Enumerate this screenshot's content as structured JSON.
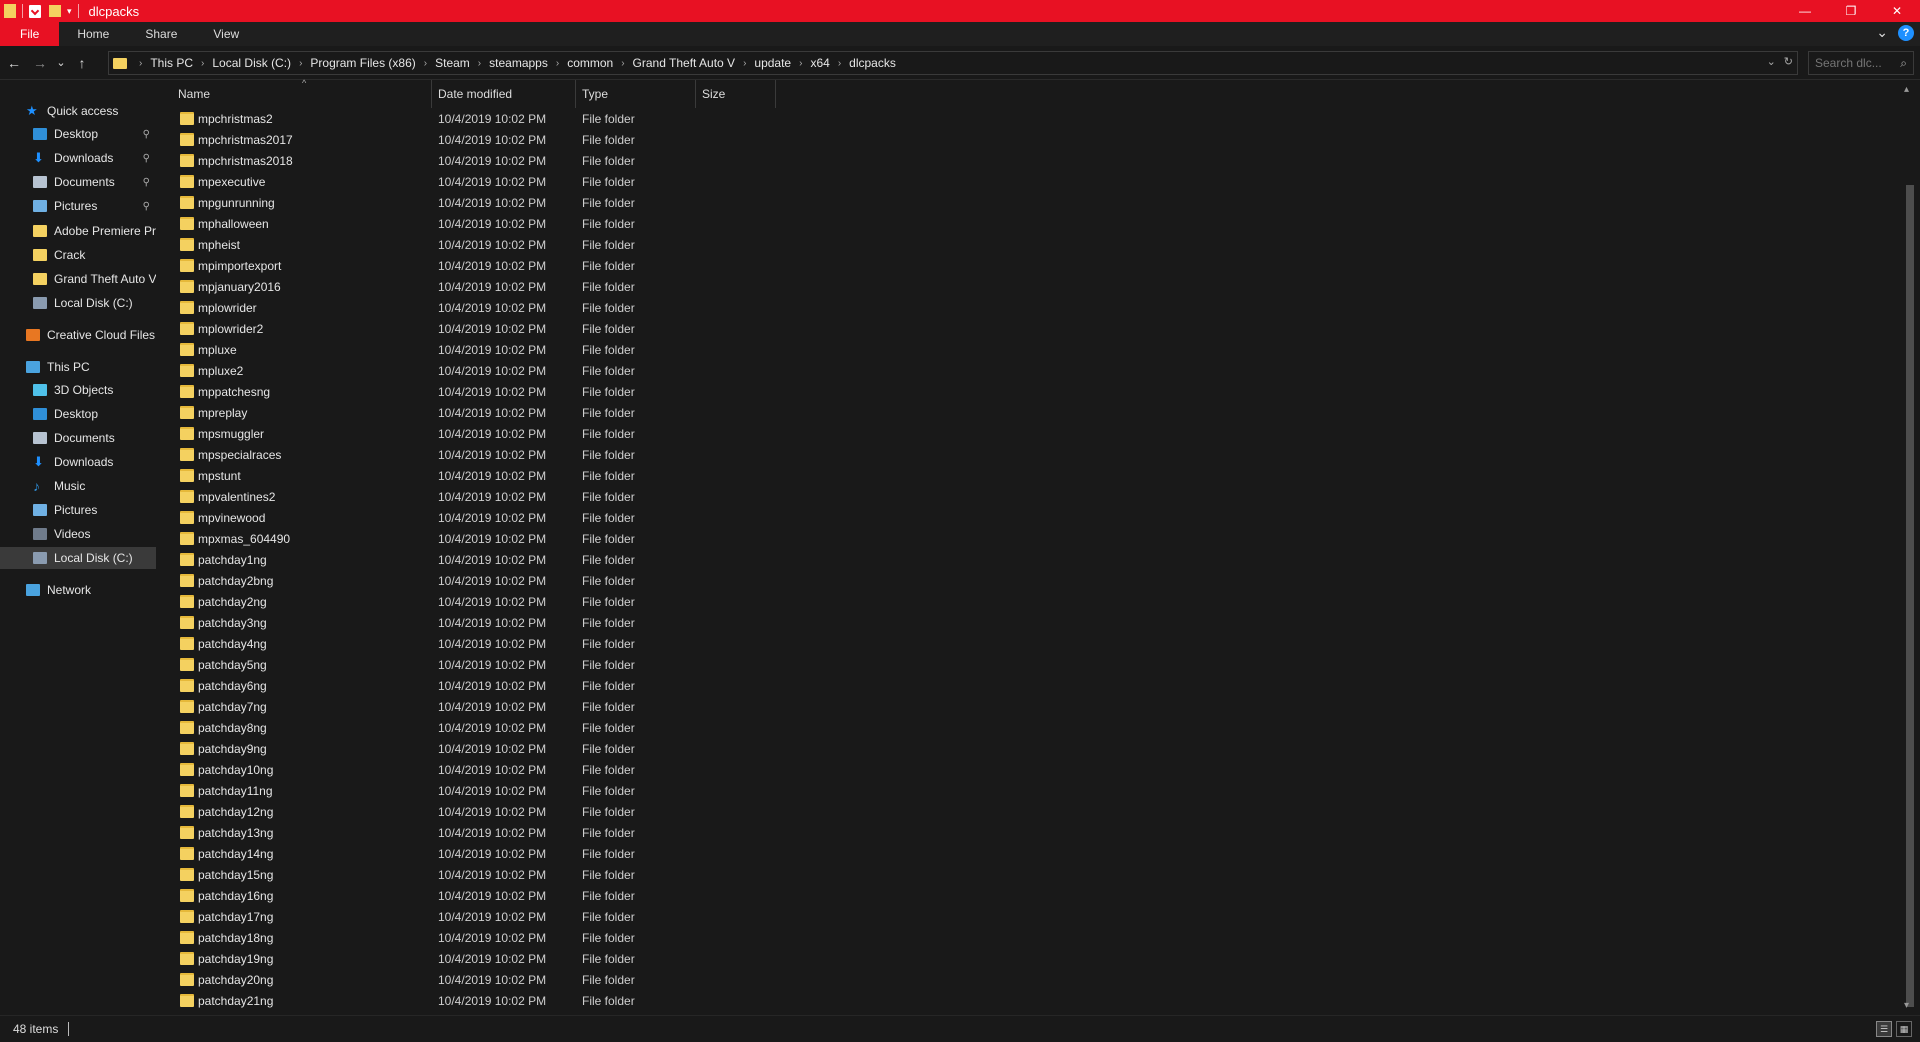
{
  "window": {
    "title": "dlcpacks",
    "controls": {
      "minimize": "—",
      "restore": "❐",
      "close": "✕"
    }
  },
  "ribbon": {
    "tabs": [
      "File",
      "Home",
      "Share",
      "View"
    ],
    "help": "?",
    "expand": "⌄"
  },
  "nav": {
    "back": "←",
    "forward": "→",
    "recent": "⌄",
    "up": "↑"
  },
  "address": {
    "crumbs": [
      "This PC",
      "Local Disk (C:)",
      "Program Files (x86)",
      "Steam",
      "steamapps",
      "common",
      "Grand Theft Auto V",
      "update",
      "x64",
      "dlcpacks"
    ],
    "dropdown": "⌄",
    "refresh": "↻"
  },
  "search": {
    "placeholder": "Search dlc...",
    "icon": "⌕"
  },
  "sidebar": {
    "items": [
      {
        "label": "Quick access",
        "icon": "star-icon",
        "color": "#1e90ff",
        "level": 0
      },
      {
        "label": "Desktop",
        "icon": "desktop-icon",
        "color": "#2f8fd8",
        "level": 1,
        "pinned": true
      },
      {
        "label": "Downloads",
        "icon": "download-icon",
        "color": "#1e90ff",
        "level": 1,
        "pinned": true
      },
      {
        "label": "Documents",
        "icon": "documents-icon",
        "color": "#b7c3d1",
        "level": 1,
        "pinned": true
      },
      {
        "label": "Pictures",
        "icon": "pictures-icon",
        "color": "#6fb0e3",
        "level": 1,
        "pinned": true
      },
      {
        "label": "Adobe Premiere Pro",
        "icon": "folder-icon",
        "color": "#f4d160",
        "level": 1
      },
      {
        "label": "Crack",
        "icon": "folder-icon",
        "color": "#f4d160",
        "level": 1
      },
      {
        "label": "Grand Theft Auto V",
        "icon": "folder-icon",
        "color": "#f4d160",
        "level": 1
      },
      {
        "label": "Local Disk (C:)",
        "icon": "drive-icon",
        "color": "#8a9bb0",
        "level": 1
      },
      {
        "label": "Creative Cloud Files",
        "icon": "creative-cloud-icon",
        "color": "#e87722",
        "level": 0
      },
      {
        "label": "This PC",
        "icon": "computer-icon",
        "color": "#4aa3df",
        "level": 0
      },
      {
        "label": "3D Objects",
        "icon": "3d-objects-icon",
        "color": "#4fc1e9",
        "level": 1
      },
      {
        "label": "Desktop",
        "icon": "desktop-icon",
        "color": "#2f8fd8",
        "level": 1
      },
      {
        "label": "Documents",
        "icon": "documents-icon",
        "color": "#b7c3d1",
        "level": 1
      },
      {
        "label": "Downloads",
        "icon": "download-icon",
        "color": "#1e90ff",
        "level": 1
      },
      {
        "label": "Music",
        "icon": "music-icon",
        "color": "#2f8fd8",
        "level": 1
      },
      {
        "label": "Pictures",
        "icon": "pictures-icon",
        "color": "#6fb0e3",
        "level": 1
      },
      {
        "label": "Videos",
        "icon": "videos-icon",
        "color": "#6f7b8b",
        "level": 1
      },
      {
        "label": "Local Disk (C:)",
        "icon": "drive-icon",
        "color": "#8a9bb0",
        "level": 1,
        "selected": true
      },
      {
        "label": "Network",
        "icon": "network-icon",
        "color": "#4aa3df",
        "level": 0
      }
    ],
    "pin_glyph": "📌"
  },
  "columns": {
    "name": "Name",
    "date": "Date modified",
    "type": "Type",
    "size": "Size"
  },
  "files": [
    {
      "name": "mpchristmas2",
      "date": "10/4/2019 10:02 PM",
      "type": "File folder"
    },
    {
      "name": "mpchristmas2017",
      "date": "10/4/2019 10:02 PM",
      "type": "File folder"
    },
    {
      "name": "mpchristmas2018",
      "date": "10/4/2019 10:02 PM",
      "type": "File folder"
    },
    {
      "name": "mpexecutive",
      "date": "10/4/2019 10:02 PM",
      "type": "File folder"
    },
    {
      "name": "mpgunrunning",
      "date": "10/4/2019 10:02 PM",
      "type": "File folder"
    },
    {
      "name": "mphalloween",
      "date": "10/4/2019 10:02 PM",
      "type": "File folder"
    },
    {
      "name": "mpheist",
      "date": "10/4/2019 10:02 PM",
      "type": "File folder"
    },
    {
      "name": "mpimportexport",
      "date": "10/4/2019 10:02 PM",
      "type": "File folder"
    },
    {
      "name": "mpjanuary2016",
      "date": "10/4/2019 10:02 PM",
      "type": "File folder"
    },
    {
      "name": "mplowrider",
      "date": "10/4/2019 10:02 PM",
      "type": "File folder"
    },
    {
      "name": "mplowrider2",
      "date": "10/4/2019 10:02 PM",
      "type": "File folder"
    },
    {
      "name": "mpluxe",
      "date": "10/4/2019 10:02 PM",
      "type": "File folder"
    },
    {
      "name": "mpluxe2",
      "date": "10/4/2019 10:02 PM",
      "type": "File folder"
    },
    {
      "name": "mppatchesng",
      "date": "10/4/2019 10:02 PM",
      "type": "File folder"
    },
    {
      "name": "mpreplay",
      "date": "10/4/2019 10:02 PM",
      "type": "File folder"
    },
    {
      "name": "mpsmuggler",
      "date": "10/4/2019 10:02 PM",
      "type": "File folder"
    },
    {
      "name": "mpspecialraces",
      "date": "10/4/2019 10:02 PM",
      "type": "File folder"
    },
    {
      "name": "mpstunt",
      "date": "10/4/2019 10:02 PM",
      "type": "File folder"
    },
    {
      "name": "mpvalentines2",
      "date": "10/4/2019 10:02 PM",
      "type": "File folder"
    },
    {
      "name": "mpvinewood",
      "date": "10/4/2019 10:02 PM",
      "type": "File folder"
    },
    {
      "name": "mpxmas_604490",
      "date": "10/4/2019 10:02 PM",
      "type": "File folder"
    },
    {
      "name": "patchday1ng",
      "date": "10/4/2019 10:02 PM",
      "type": "File folder"
    },
    {
      "name": "patchday2bng",
      "date": "10/4/2019 10:02 PM",
      "type": "File folder"
    },
    {
      "name": "patchday2ng",
      "date": "10/4/2019 10:02 PM",
      "type": "File folder"
    },
    {
      "name": "patchday3ng",
      "date": "10/4/2019 10:02 PM",
      "type": "File folder"
    },
    {
      "name": "patchday4ng",
      "date": "10/4/2019 10:02 PM",
      "type": "File folder"
    },
    {
      "name": "patchday5ng",
      "date": "10/4/2019 10:02 PM",
      "type": "File folder"
    },
    {
      "name": "patchday6ng",
      "date": "10/4/2019 10:02 PM",
      "type": "File folder"
    },
    {
      "name": "patchday7ng",
      "date": "10/4/2019 10:02 PM",
      "type": "File folder"
    },
    {
      "name": "patchday8ng",
      "date": "10/4/2019 10:02 PM",
      "type": "File folder"
    },
    {
      "name": "patchday9ng",
      "date": "10/4/2019 10:02 PM",
      "type": "File folder"
    },
    {
      "name": "patchday10ng",
      "date": "10/4/2019 10:02 PM",
      "type": "File folder"
    },
    {
      "name": "patchday11ng",
      "date": "10/4/2019 10:02 PM",
      "type": "File folder"
    },
    {
      "name": "patchday12ng",
      "date": "10/4/2019 10:02 PM",
      "type": "File folder"
    },
    {
      "name": "patchday13ng",
      "date": "10/4/2019 10:02 PM",
      "type": "File folder"
    },
    {
      "name": "patchday14ng",
      "date": "10/4/2019 10:02 PM",
      "type": "File folder"
    },
    {
      "name": "patchday15ng",
      "date": "10/4/2019 10:02 PM",
      "type": "File folder"
    },
    {
      "name": "patchday16ng",
      "date": "10/4/2019 10:02 PM",
      "type": "File folder"
    },
    {
      "name": "patchday17ng",
      "date": "10/4/2019 10:02 PM",
      "type": "File folder"
    },
    {
      "name": "patchday18ng",
      "date": "10/4/2019 10:02 PM",
      "type": "File folder"
    },
    {
      "name": "patchday19ng",
      "date": "10/4/2019 10:02 PM",
      "type": "File folder"
    },
    {
      "name": "patchday20ng",
      "date": "10/4/2019 10:02 PM",
      "type": "File folder"
    },
    {
      "name": "patchday21ng",
      "date": "10/4/2019 10:02 PM",
      "type": "File folder"
    }
  ],
  "status": {
    "items_count": "48 items"
  },
  "colors": {
    "accent": "#e81123",
    "folder": "#f4d160",
    "background": "#191919",
    "selected": "#3a3a3a"
  }
}
